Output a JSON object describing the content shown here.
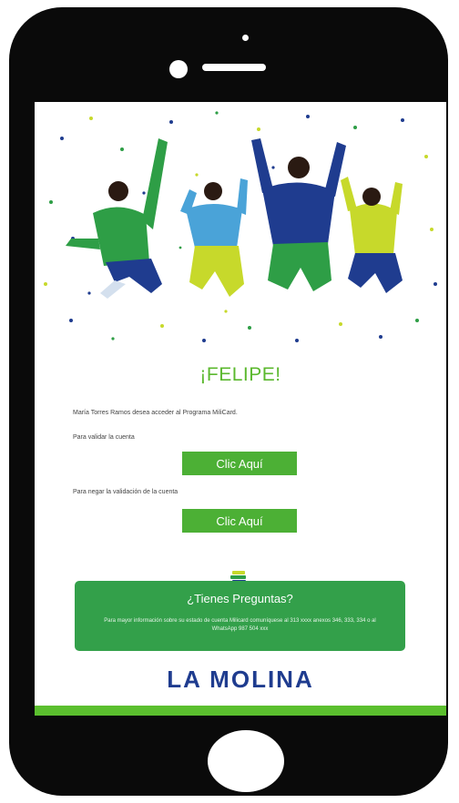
{
  "email": {
    "greeting": "¡FELIPE!",
    "intro_text": "María Torres Ramos desea acceder al Programa MiliCard.",
    "validate_text": "Para validar la cuenta",
    "validate_button": "Clic Aquí",
    "deny_text": "Para negar la validación de la cuenta",
    "deny_button": "Clic Aquí",
    "help": {
      "title": "¿Tienes Preguntas?",
      "body": "Para mayor información sobre su estado de cuenta Milicard comuníquese al 313 xxxx anexos 346, 333, 334 o al WhatsApp 987 504 xxx"
    },
    "logo_text": "LA MOLINA"
  },
  "colors": {
    "phone_frame": "#0a0a0a",
    "brand_green": "#4cb035",
    "help_box_green": "#33a04a",
    "logo_blue": "#1f3c8f",
    "logo_lime": "#c7d92b"
  },
  "icons": {
    "help_icon": "books-stack-icon"
  }
}
